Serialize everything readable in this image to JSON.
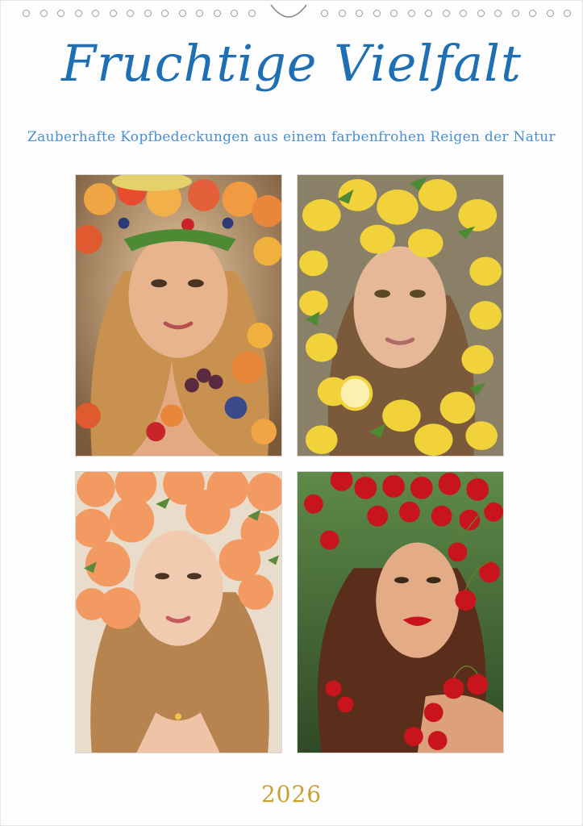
{
  "calendar": {
    "title": "Fruchtige Vielfalt",
    "subtitle": "Zauberhafte Kopfbedeckungen aus einem farbenfrohen Reigen der Natur",
    "year": "2026"
  },
  "photos": [
    {
      "name": "photo-mixed-fruit",
      "fruit_color": "#e8863a",
      "accent": "#3b4a8a"
    },
    {
      "name": "photo-lemons",
      "fruit_color": "#f1d23a",
      "accent": "#4e8a34"
    },
    {
      "name": "photo-peaches",
      "fruit_color": "#f29a62",
      "accent": "#5a8a3a"
    },
    {
      "name": "photo-cherries",
      "fruit_color": "#c8141c",
      "accent": "#3f6e2e"
    }
  ],
  "colors": {
    "title": "#1f6fb5",
    "subtitle": "#4a8fcf",
    "year": "#c9a032"
  }
}
